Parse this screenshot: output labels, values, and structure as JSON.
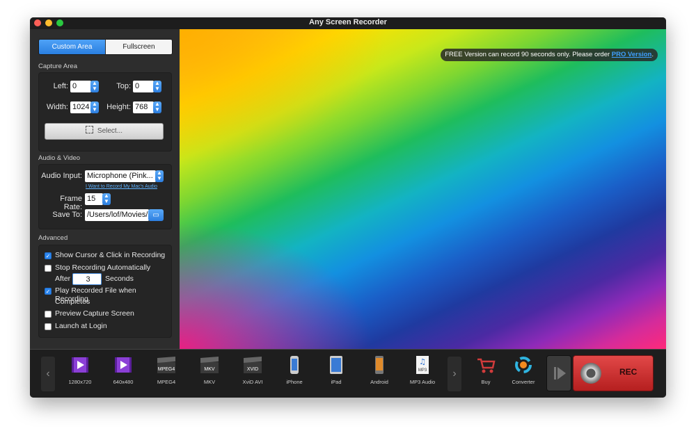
{
  "window": {
    "title": "Any Screen Recorder"
  },
  "mode_tabs": {
    "custom": "Custom Area",
    "full": "Fullscreen"
  },
  "capture": {
    "section": "Capture Area",
    "left_label": "Left:",
    "left_value": "0",
    "top_label": "Top:",
    "top_value": "0",
    "width_label": "Width:",
    "width_value": "1024",
    "height_label": "Height:",
    "height_value": "768",
    "select_label": "Select..."
  },
  "audio_video": {
    "section": "Audio & Video",
    "input_label": "Audio Input:",
    "input_value": "Microphone (Pink...",
    "mac_audio_link": "I Want to Record My Mac's Audio",
    "fps_label": "Frame Rate:",
    "fps_value": "15",
    "save_label": "Save To:",
    "save_value": "/Users/lof/Movies/"
  },
  "advanced": {
    "section": "Advanced",
    "show_cursor": "Show Cursor & Click in Recording",
    "stop_auto": "Stop Recording Automatically",
    "after": "After",
    "after_value": "3",
    "seconds": "Seconds",
    "play_recorded_1": "Play Recorded File when Recording",
    "play_recorded_2": "Completes",
    "preview": "Preview Capture Screen",
    "launch": "Launch at Login",
    "checked": {
      "show_cursor": true,
      "stop_auto": false,
      "play_recorded": true,
      "preview": false,
      "launch": false
    }
  },
  "notice": {
    "text": "FREE Version can record 90 seconds only. Please order ",
    "link": "PRO Version",
    "tail": "."
  },
  "formats": [
    "1280x720",
    "640x480",
    "MPEG4",
    "MKV",
    "XviD AVI",
    "iPhone",
    "iPad",
    "Android",
    "MP3 Audio"
  ],
  "format_icons": {
    "mpeg4": "MPEG4",
    "mkv": "MKV",
    "xvid": "XVID",
    "mp3": "MP3"
  },
  "actions": {
    "buy": "Buy",
    "converter": "Converter",
    "rec": "REC"
  },
  "colors": {
    "accent": "#2d86ee",
    "rec": "#d63a3a",
    "link": "#3fa0ff"
  }
}
